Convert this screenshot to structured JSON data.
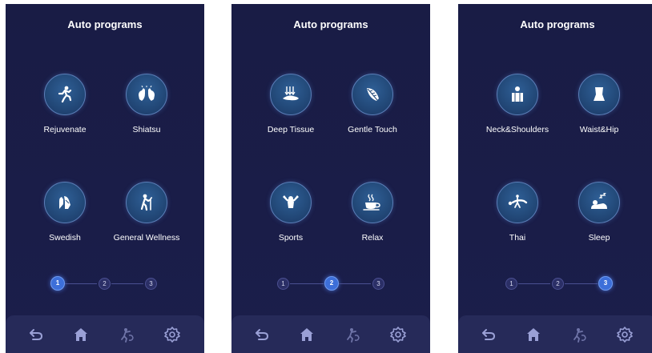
{
  "screens": [
    {
      "title": "Auto programs",
      "programs": [
        {
          "label": "Rejuvenate",
          "icon": "running-person-icon"
        },
        {
          "label": "Shiatsu",
          "icon": "hands-icon"
        },
        {
          "label": "Swedish",
          "icon": "palms-icon"
        },
        {
          "label": "General Wellness",
          "icon": "elderly-person-icon"
        }
      ],
      "pager": [
        "1",
        "2",
        "3"
      ],
      "active_page": 1
    },
    {
      "title": "Auto programs",
      "programs": [
        {
          "label": "Deep Tissue",
          "icon": "deep-pressure-icon"
        },
        {
          "label": "Gentle Touch",
          "icon": "feather-icon"
        },
        {
          "label": "Sports",
          "icon": "cheering-person-icon"
        },
        {
          "label": "Relax",
          "icon": "coffee-cup-icon"
        }
      ],
      "pager": [
        "1",
        "2",
        "3"
      ],
      "active_page": 2
    },
    {
      "title": "Auto programs",
      "programs": [
        {
          "label": "Neck&Shoulders",
          "icon": "neck-shoulders-icon"
        },
        {
          "label": "Waist&Hip",
          "icon": "waist-hip-icon"
        },
        {
          "label": "Thai",
          "icon": "thai-stretch-icon"
        },
        {
          "label": "Sleep",
          "icon": "sleep-icon"
        }
      ],
      "pager": [
        "1",
        "2",
        "3"
      ],
      "active_page": 3
    }
  ],
  "bottom_bar": [
    "back-icon",
    "home-icon",
    "manual-massage-icon",
    "settings-icon"
  ],
  "colors": {
    "background": "#1a1d48",
    "circle": "#234a7a",
    "active_dot": "#3d6fd9",
    "bottom_bar": "#262a59",
    "text": "#ffffff"
  }
}
